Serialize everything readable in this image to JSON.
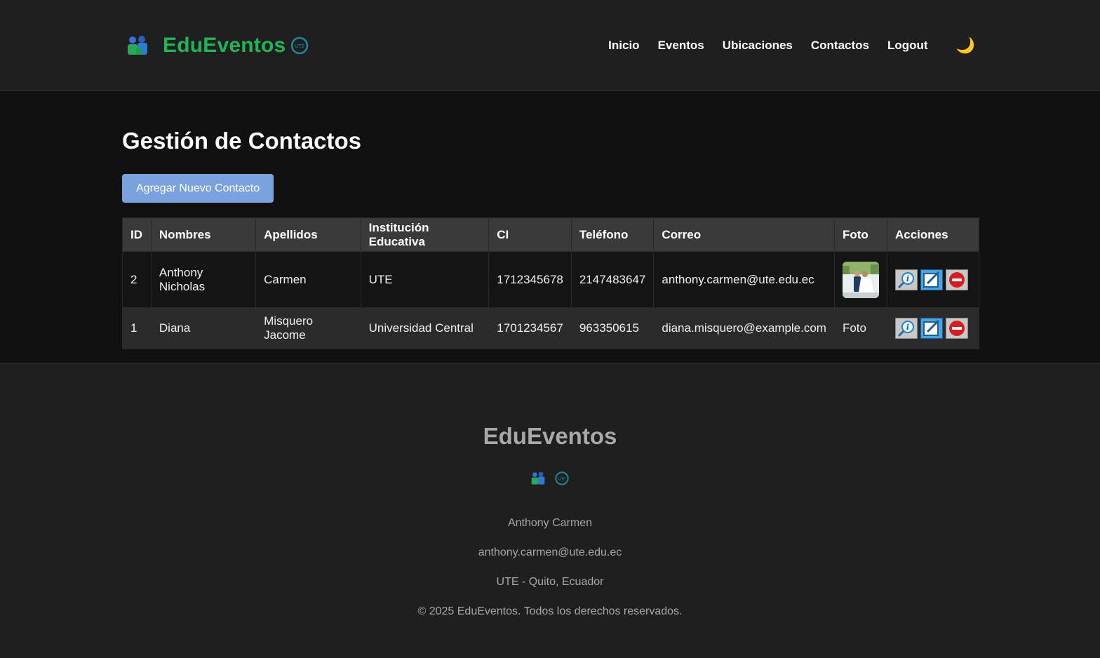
{
  "header": {
    "brand": "EduEventos",
    "nav": [
      "Inicio",
      "Eventos",
      "Ubicaciones",
      "Contactos",
      "Logout"
    ],
    "theme_icon": "moon-icon"
  },
  "main": {
    "title": "Gestión de Contactos",
    "add_button": "Agregar Nuevo Contacto",
    "table": {
      "headers": [
        "ID",
        "Nombres",
        "Apellidos",
        "Institución Educativa",
        "CI",
        "Teléfono",
        "Correo",
        "Foto",
        "Acciones"
      ],
      "rows": [
        {
          "id": "2",
          "nombres": "Anthony Nicholas",
          "apellidos": "Carmen",
          "institucion": "UTE",
          "ci": "1712345678",
          "telefono": "2147483647",
          "correo": "anthony.carmen@ute.edu.ec",
          "foto": "photo-thumbnail"
        },
        {
          "id": "1",
          "nombres": "Diana",
          "apellidos": "Misquero Jacome",
          "institucion": "Universidad Central",
          "ci": "1701234567",
          "telefono": "963350615",
          "correo": "diana.misquero@example.com",
          "foto": "Foto"
        }
      ]
    }
  },
  "footer": {
    "title": "EduEventos",
    "name": "Anthony Carmen",
    "email": "anthony.carmen@ute.edu.ec",
    "location": "UTE - Quito, Ecuador",
    "copyright": "© 2025 EduEventos. Todos los derechos reservados."
  },
  "colors": {
    "brand_green": "#22b45a",
    "button_blue": "#7aa2df",
    "header_bg": "#1f1f1f",
    "main_bg": "#111111"
  }
}
